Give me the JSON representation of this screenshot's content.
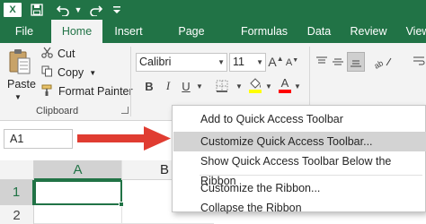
{
  "quick_access": {
    "app_letter": "X",
    "icons": [
      "excel-logo",
      "save-icon",
      "undo-icon",
      "redo-icon",
      "customize-qat-icon"
    ]
  },
  "tabs": [
    {
      "label": "File",
      "active": false
    },
    {
      "label": "Home",
      "active": true
    },
    {
      "label": "Insert",
      "active": false
    },
    {
      "label": "Page Layout",
      "active": false
    },
    {
      "label": "Formulas",
      "active": false
    },
    {
      "label": "Data",
      "active": false
    },
    {
      "label": "Review",
      "active": false
    },
    {
      "label": "View",
      "active": false
    }
  ],
  "clipboard": {
    "paste_label": "Paste",
    "cut_label": "Cut",
    "copy_label": "Copy",
    "format_painter_label": "Format Painter",
    "group_label": "Clipboard"
  },
  "font": {
    "name": "Calibri",
    "size": "11",
    "bold": "B",
    "italic": "I",
    "underline": "U",
    "font_color_glyph": "A",
    "fill_color": "#ffff00",
    "font_color": "#ff0000"
  },
  "name_box": {
    "value": "A1"
  },
  "grid": {
    "columns": [
      "A",
      "B"
    ],
    "rows": [
      "1",
      "2"
    ]
  },
  "context_menu": {
    "items": [
      {
        "label": "Add to Quick Access Toolbar",
        "highlighted": false
      },
      {
        "label": "Customize Quick Access Toolbar...",
        "highlighted": true
      },
      {
        "label": "Show Quick Access Toolbar Below the Ribbon",
        "highlighted": false
      },
      {
        "label": "Customize the Ribbon...",
        "highlighted": false
      },
      {
        "label": "Collapse the Ribbon",
        "highlighted": false
      }
    ]
  },
  "colors": {
    "brand": "#217346",
    "arrow": "#e03c31",
    "menu_highlight": "#d3d3d3"
  }
}
